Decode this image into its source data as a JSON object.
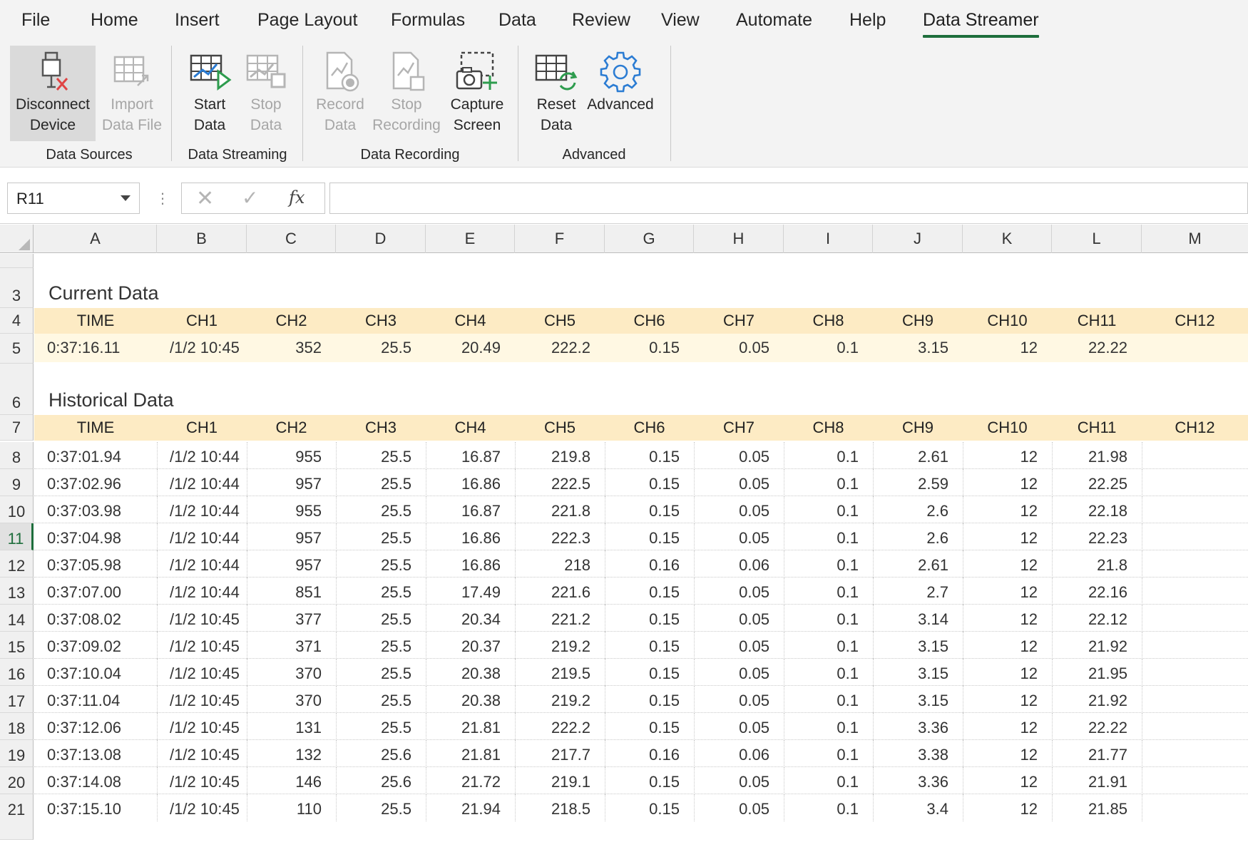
{
  "menu": {
    "tabs": [
      "File",
      "Home",
      "Insert",
      "Page Layout",
      "Formulas",
      "Data",
      "Review",
      "View",
      "Automate",
      "Help",
      "Data Streamer"
    ]
  },
  "ribbon": {
    "buttons": {
      "disconnect": [
        "Disconnect",
        "Device"
      ],
      "import": [
        "Import",
        "Data File"
      ],
      "start": [
        "Start",
        "Data"
      ],
      "stop": [
        "Stop",
        "Data"
      ],
      "record": [
        "Record",
        "Data"
      ],
      "stop_recording": [
        "Stop",
        "Recording"
      ],
      "capture": [
        "Capture",
        "Screen"
      ],
      "reset": [
        "Reset",
        "Data"
      ],
      "advanced": [
        "Advanced",
        ""
      ]
    },
    "groups": {
      "sources": "Data Sources",
      "streaming": "Data Streaming",
      "recording": "Data Recording",
      "advanced": "Advanced"
    },
    "icons": {
      "disconnect": "usb-disconnect-icon",
      "import": "import-file-icon",
      "start": "start-data-icon",
      "stop": "stop-data-icon",
      "record": "record-data-icon",
      "stop_recording": "stop-recording-icon",
      "capture": "capture-screen-icon",
      "reset": "reset-data-icon",
      "advanced": "gear-icon"
    },
    "accent": "#1e6e3c"
  },
  "formula_bar": {
    "name_box": "R11",
    "dots": "⋮",
    "cancel": "✕",
    "enter": "✓",
    "fx": "fx",
    "value": ""
  },
  "grid": {
    "columns": [
      "A",
      "B",
      "C",
      "D",
      "E",
      "F",
      "G",
      "H",
      "I",
      "J",
      "K",
      "L",
      "M"
    ],
    "selected_row": "11",
    "sections": {
      "current_title": "Current Data",
      "historical_title": "Historical Data"
    },
    "header_labels": [
      "TIME",
      "CH1",
      "CH2",
      "CH3",
      "CH4",
      "CH5",
      "CH6",
      "CH7",
      "CH8",
      "CH9",
      "CH10",
      "CH11",
      "CH12"
    ],
    "current_row": {
      "row": "5",
      "values": [
        "0:37:16.11",
        "/1/2 10:45",
        "352",
        "25.5",
        "20.49",
        "222.2",
        "0.15",
        "0.05",
        "0.1",
        "3.15",
        "12",
        "22.22",
        ""
      ]
    },
    "historical_rows": [
      {
        "row": "8",
        "values": [
          "0:37:01.94",
          "/1/2 10:44",
          "955",
          "25.5",
          "16.87",
          "219.8",
          "0.15",
          "0.05",
          "0.1",
          "2.61",
          "12",
          "21.98",
          ""
        ]
      },
      {
        "row": "9",
        "values": [
          "0:37:02.96",
          "/1/2 10:44",
          "957",
          "25.5",
          "16.86",
          "222.5",
          "0.15",
          "0.05",
          "0.1",
          "2.59",
          "12",
          "22.25",
          ""
        ]
      },
      {
        "row": "10",
        "values": [
          "0:37:03.98",
          "/1/2 10:44",
          "955",
          "25.5",
          "16.87",
          "221.8",
          "0.15",
          "0.05",
          "0.1",
          "2.6",
          "12",
          "22.18",
          ""
        ]
      },
      {
        "row": "11",
        "values": [
          "0:37:04.98",
          "/1/2 10:44",
          "957",
          "25.5",
          "16.86",
          "222.3",
          "0.15",
          "0.05",
          "0.1",
          "2.6",
          "12",
          "22.23",
          ""
        ]
      },
      {
        "row": "12",
        "values": [
          "0:37:05.98",
          "/1/2 10:44",
          "957",
          "25.5",
          "16.86",
          "218",
          "0.16",
          "0.06",
          "0.1",
          "2.61",
          "12",
          "21.8",
          ""
        ]
      },
      {
        "row": "13",
        "values": [
          "0:37:07.00",
          "/1/2 10:44",
          "851",
          "25.5",
          "17.49",
          "221.6",
          "0.15",
          "0.05",
          "0.1",
          "2.7",
          "12",
          "22.16",
          ""
        ]
      },
      {
        "row": "14",
        "values": [
          "0:37:08.02",
          "/1/2 10:45",
          "377",
          "25.5",
          "20.34",
          "221.2",
          "0.15",
          "0.05",
          "0.1",
          "3.14",
          "12",
          "22.12",
          ""
        ]
      },
      {
        "row": "15",
        "values": [
          "0:37:09.02",
          "/1/2 10:45",
          "371",
          "25.5",
          "20.37",
          "219.2",
          "0.15",
          "0.05",
          "0.1",
          "3.15",
          "12",
          "21.92",
          ""
        ]
      },
      {
        "row": "16",
        "values": [
          "0:37:10.04",
          "/1/2 10:45",
          "370",
          "25.5",
          "20.38",
          "219.5",
          "0.15",
          "0.05",
          "0.1",
          "3.15",
          "12",
          "21.95",
          ""
        ]
      },
      {
        "row": "17",
        "values": [
          "0:37:11.04",
          "/1/2 10:45",
          "370",
          "25.5",
          "20.38",
          "219.2",
          "0.15",
          "0.05",
          "0.1",
          "3.15",
          "12",
          "21.92",
          ""
        ]
      },
      {
        "row": "18",
        "values": [
          "0:37:12.06",
          "/1/2 10:45",
          "131",
          "25.5",
          "21.81",
          "222.2",
          "0.15",
          "0.05",
          "0.1",
          "3.36",
          "12",
          "22.22",
          ""
        ]
      },
      {
        "row": "19",
        "values": [
          "0:37:13.08",
          "/1/2 10:45",
          "132",
          "25.6",
          "21.81",
          "217.7",
          "0.16",
          "0.06",
          "0.1",
          "3.38",
          "12",
          "21.77",
          ""
        ]
      },
      {
        "row": "20",
        "values": [
          "0:37:14.08",
          "/1/2 10:45",
          "146",
          "25.6",
          "21.72",
          "219.1",
          "0.15",
          "0.05",
          "0.1",
          "3.36",
          "12",
          "21.91",
          ""
        ]
      },
      {
        "row": "21",
        "values": [
          "0:37:15.10",
          "/1/2 10:45",
          "110",
          "25.5",
          "21.94",
          "218.5",
          "0.15",
          "0.05",
          "0.1",
          "3.4",
          "12",
          "21.85",
          ""
        ]
      }
    ],
    "row_numbers_misc": [
      "3",
      "4",
      "6",
      "7"
    ]
  }
}
